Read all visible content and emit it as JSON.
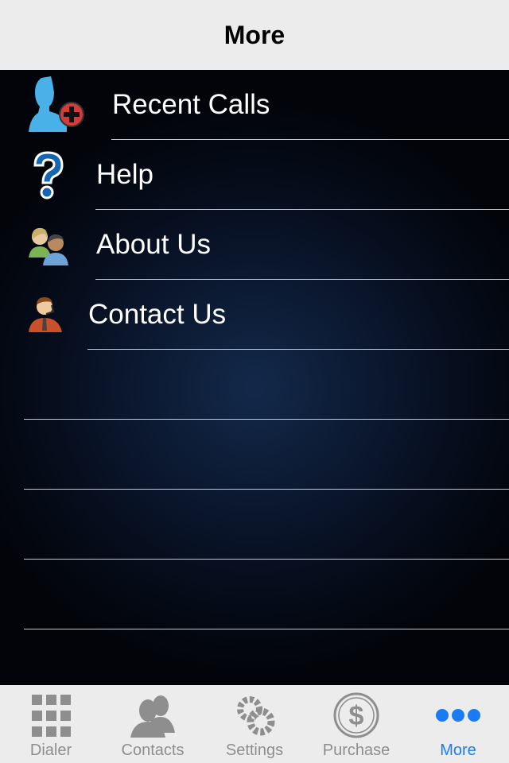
{
  "navbar": {
    "title": "More"
  },
  "menu": {
    "items": [
      {
        "label": "Recent Calls",
        "icon": "user-add-icon"
      },
      {
        "label": "Help",
        "icon": "question-icon"
      },
      {
        "label": "About Us",
        "icon": "people-icon"
      },
      {
        "label": "Contact Us",
        "icon": "support-agent-icon"
      }
    ]
  },
  "tabbar": {
    "tabs": [
      {
        "label": "Dialer",
        "icon": "keypad-icon",
        "active": false
      },
      {
        "label": "Contacts",
        "icon": "contacts-icon",
        "active": false
      },
      {
        "label": "Settings",
        "icon": "gears-icon",
        "active": false
      },
      {
        "label": "Purchase",
        "icon": "dollar-icon",
        "active": false
      },
      {
        "label": "More",
        "icon": "more-dots-icon",
        "active": true
      }
    ]
  },
  "colors": {
    "active_tab": "#1a7cf5",
    "inactive_tab": "#8e8e8e"
  }
}
